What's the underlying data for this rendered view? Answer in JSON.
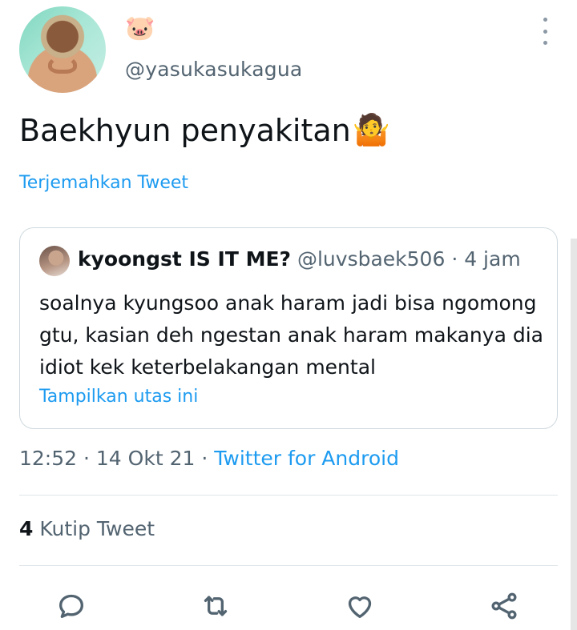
{
  "author": {
    "display_name_emoji": "🐷",
    "handle": "@yasukasukagua"
  },
  "tweet": {
    "text": "Baekhyun penyakitan",
    "trailing_emoji": "🤷",
    "translate_label": "Terjemahkan Tweet"
  },
  "quoted_tweet": {
    "name": "kyoongst IS IT ME?",
    "handle": "@luvsbaek506",
    "time": "· 4 jam",
    "text": "soalnya kyungsoo anak haram jadi bisa ngomong gtu, kasian deh ngestan anak haram makanya dia idiot kek keterbelakangan mental",
    "show_thread_label": "Tampilkan utas ini"
  },
  "meta": {
    "time": "12:52",
    "sep1": "·",
    "date": "14 Okt 21",
    "sep2": "·",
    "source": "Twitter for Android"
  },
  "stats": {
    "quote_count": "4",
    "quote_label": "Kutip Tweet"
  },
  "actions": {
    "icons": [
      "reply-icon",
      "retweet-icon",
      "like-icon",
      "share-icon"
    ]
  },
  "colors": {
    "accent": "#1d9bf0",
    "secondary_text": "#536471",
    "border": "#cfd9de"
  }
}
